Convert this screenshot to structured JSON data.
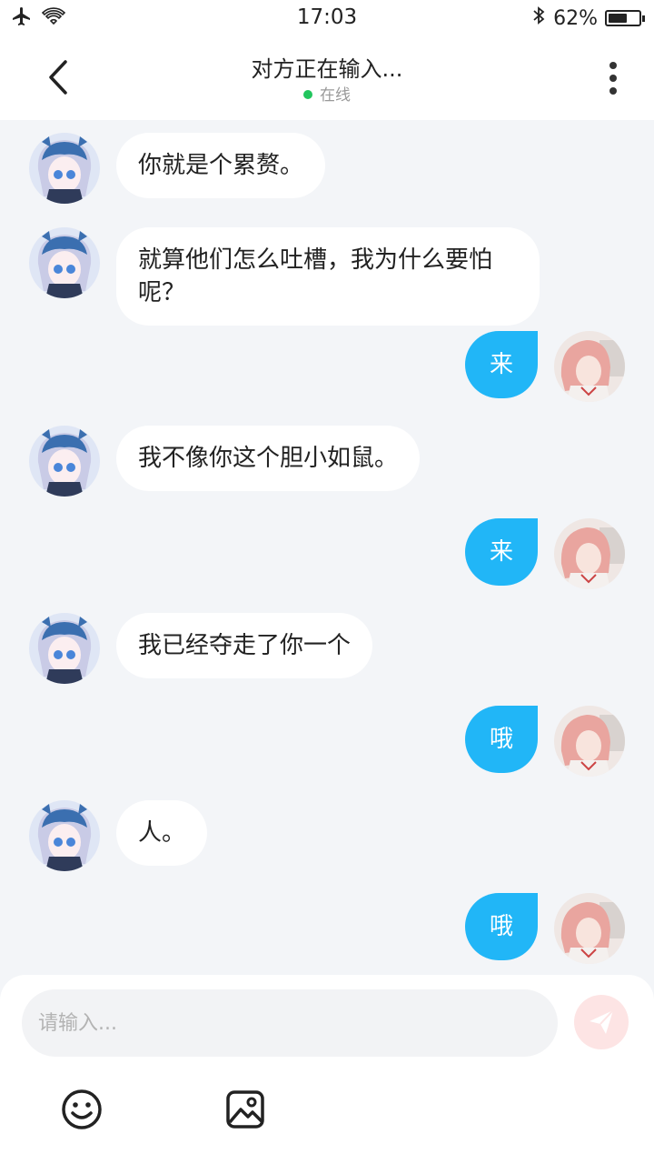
{
  "status_bar": {
    "time": "17:03",
    "battery": "62%",
    "battery_level": 0.62
  },
  "header": {
    "title": "对方正在输入...",
    "status": "在线"
  },
  "messages": [
    {
      "side": "left",
      "text": "你就是个累赘。"
    },
    {
      "side": "left",
      "text": "就算他们怎么吐槽，我为什么要怕呢？"
    },
    {
      "side": "right",
      "text": "来"
    },
    {
      "side": "left",
      "text": "我不像你这个胆小如鼠。"
    },
    {
      "side": "right",
      "text": "来"
    },
    {
      "side": "left",
      "text": "我已经夺走了你一个"
    },
    {
      "side": "right",
      "text": "哦"
    },
    {
      "side": "left",
      "text": "人。"
    },
    {
      "side": "right",
      "text": "哦"
    }
  ],
  "composer": {
    "placeholder": "请输入..."
  },
  "icons": {
    "back": "chevron-left-icon",
    "more": "more-vertical-icon",
    "send": "send-icon",
    "emoji": "emoji-icon",
    "image": "image-icon"
  },
  "colors": {
    "outgoing_bubble": "#21b6f7",
    "online_dot": "#22c55e",
    "send_button": "#fde4e4"
  }
}
